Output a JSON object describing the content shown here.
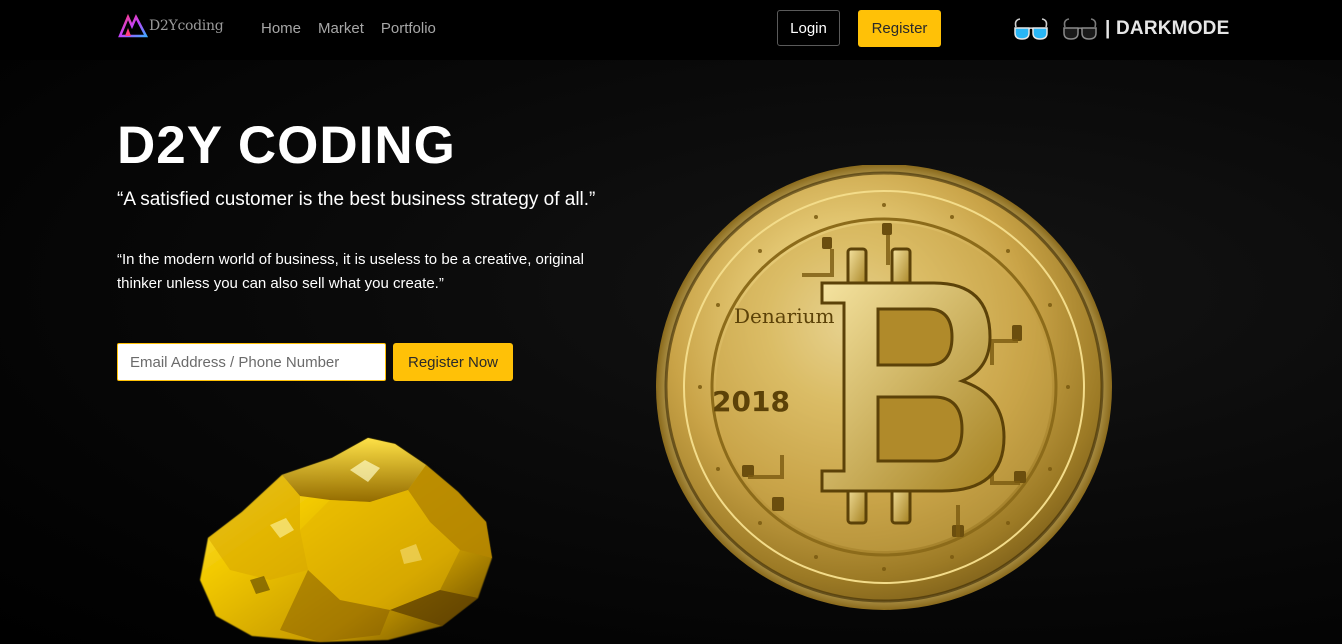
{
  "brand": {
    "logo_text": "D2Ycoding"
  },
  "nav": {
    "links": [
      {
        "label": "Home"
      },
      {
        "label": "Market"
      },
      {
        "label": "Portfolio"
      }
    ],
    "login_label": "Login",
    "register_label": "Register",
    "darkmode_label": "| DARKMODE",
    "light_icon": "glasses-light-icon",
    "dark_icon": "glasses-dark-icon"
  },
  "hero": {
    "title": "D2Y CODING",
    "quote_primary": "“A satisfied customer is the best business strategy of all.”",
    "quote_secondary": "“In the modern world of business, it is useless to be a creative, original thinker unless you can also sell what you create.”",
    "email_placeholder": "Email Address / Phone Number",
    "cta_label": "Register Now"
  },
  "images": {
    "nugget": "gold-nugget-image",
    "coin": "bitcoin-coin-image",
    "coin_text_top": "Denarium",
    "coin_year": "2018"
  },
  "colors": {
    "accent": "#ffc107",
    "background": "#000000",
    "nav_link": "#a7a7a7",
    "light_glasses_lens": "#29b6f6"
  }
}
